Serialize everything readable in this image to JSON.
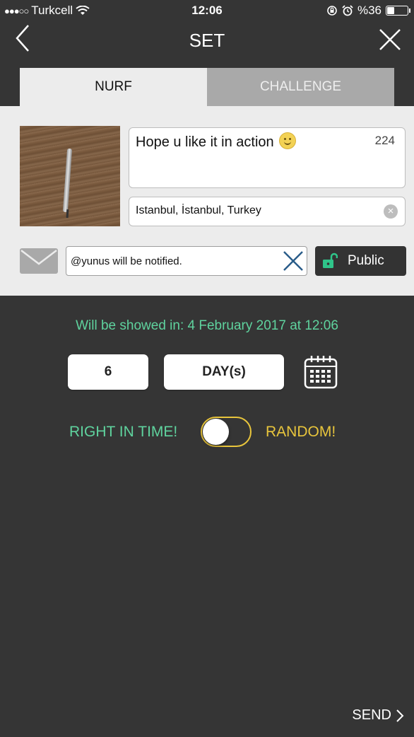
{
  "status_bar": {
    "signal": "●●●○○",
    "carrier": "Turkcell",
    "time": "12:06",
    "battery": "%36"
  },
  "nav": {
    "title": "SET"
  },
  "tabs": [
    {
      "label": "NURF",
      "active": true
    },
    {
      "label": "CHALLENGE",
      "active": false
    }
  ],
  "post": {
    "caption": "Hope u like it in action",
    "char_count": "224",
    "location": "Istanbul, İstanbul, Turkey",
    "notify_text": "@yunus will be notified.",
    "visibility_label": "Public"
  },
  "schedule": {
    "showed_in": "Will be showed in: 4 February 2017 at 12:06",
    "amount": "6",
    "unit": "DAY(s)",
    "mode_left": "RIGHT IN TIME!",
    "mode_right": "RANDOM!",
    "toggle_on": false
  },
  "footer": {
    "send_label": "SEND"
  },
  "colors": {
    "background": "#353535",
    "panel": "#ececec",
    "green": "#5fd39e",
    "yellow": "#e8c53c"
  },
  "icons": [
    "wifi-icon",
    "lock-rotation-icon",
    "alarm-icon",
    "battery-icon",
    "back-chevron-icon",
    "close-icon",
    "smiley-icon",
    "clear-icon",
    "mail-icon",
    "remove-x-icon",
    "unlock-icon",
    "calendar-icon",
    "chevron-right-icon"
  ]
}
